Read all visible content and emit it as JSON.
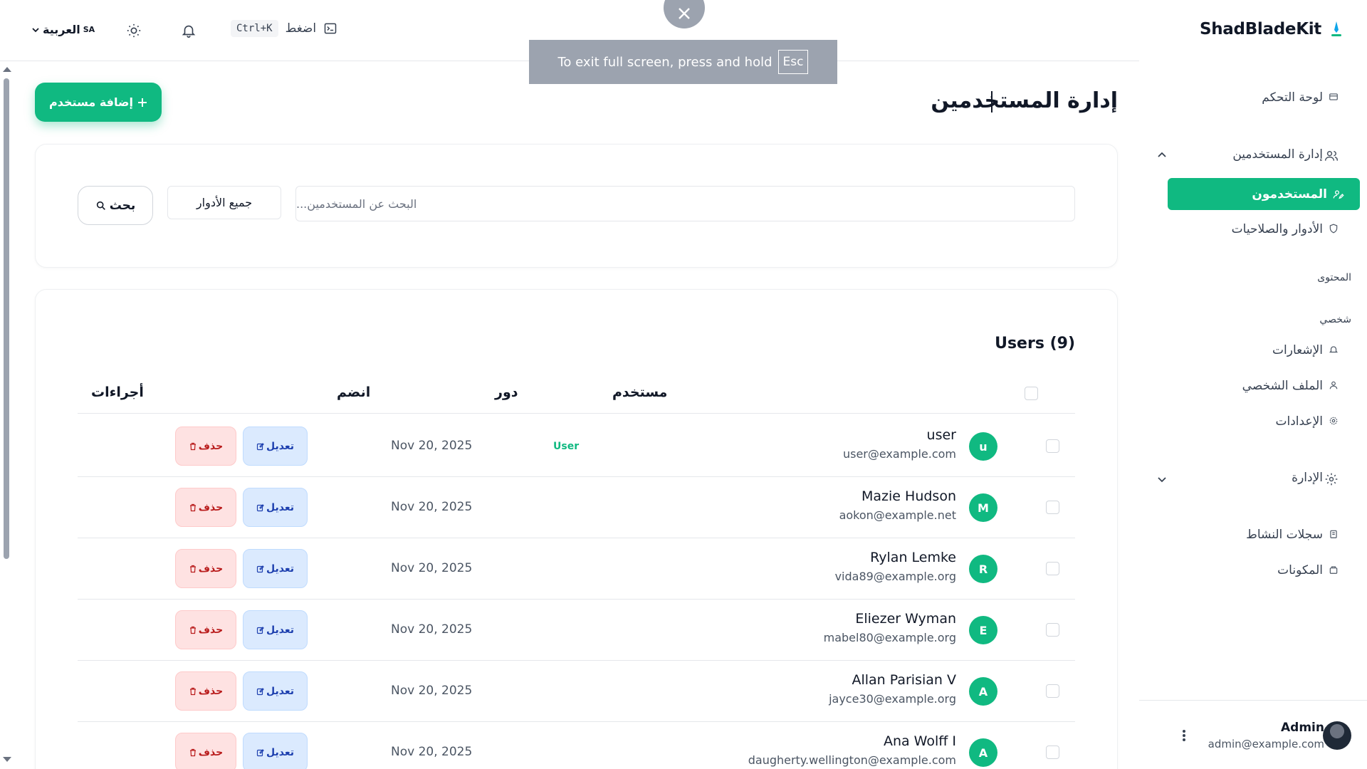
{
  "brand": {
    "name": "ShadBladeKit"
  },
  "header": {
    "language_label": "العربية",
    "language_code": "SA",
    "shortcut_key": "Ctrl+K",
    "shortcut_press": "اضغط"
  },
  "fullscreen": {
    "message": "To exit full screen, press and hold",
    "key": "Esc"
  },
  "sidebar": {
    "dashboard": "لوحة التحكم",
    "user_management": "إدارة المستخدمين",
    "users": "المستخدمون",
    "roles_permissions": "الأدوار والصلاحيات",
    "section_content": "المحتوى",
    "section_personal": "شخصي",
    "notifications": "الإشعارات",
    "profile": "الملف الشخصي",
    "settings": "الإعدادات",
    "administration": "الإدارة",
    "activity_logs": "سجلات النشاط",
    "components": "المكونات",
    "footer": {
      "name": "Admin",
      "email": "admin@example.com"
    }
  },
  "page": {
    "title": "إدارة المستخدمين",
    "add_user_label": "إضافة مستخدم",
    "search_placeholder": "البحث عن المستخدمين...",
    "role_filter_value": "جميع الأدوار",
    "search_button_label": "بحث"
  },
  "table": {
    "title": "Users (9)",
    "columns": {
      "user": "مستخدم",
      "role": "دور",
      "joined": "انضم",
      "actions": "أجراءات"
    },
    "edit_label": "تعديل",
    "delete_label": "حذف",
    "rows": [
      {
        "initial": "u",
        "name": "user",
        "email": "user@example.com",
        "role": "User",
        "joined": "Nov 20, 2025"
      },
      {
        "initial": "M",
        "name": "Mazie Hudson",
        "email": "aokon@example.net",
        "role": "",
        "joined": "Nov 20, 2025"
      },
      {
        "initial": "R",
        "name": "Rylan Lemke",
        "email": "vida89@example.org",
        "role": "",
        "joined": "Nov 20, 2025"
      },
      {
        "initial": "E",
        "name": "Eliezer Wyman",
        "email": "mabel80@example.org",
        "role": "",
        "joined": "Nov 20, 2025"
      },
      {
        "initial": "A",
        "name": "Allan Parisian V",
        "email": "jayce30@example.org",
        "role": "",
        "joined": "Nov 20, 2025"
      },
      {
        "initial": "A",
        "name": "Ana Wolff I",
        "email": "daugherty.wellington@example.com",
        "role": "",
        "joined": "Nov 20, 2025"
      }
    ]
  },
  "colors": {
    "accent": "#10b981",
    "edit_bg": "#dbeafe",
    "delete_bg": "#fee2e2"
  }
}
